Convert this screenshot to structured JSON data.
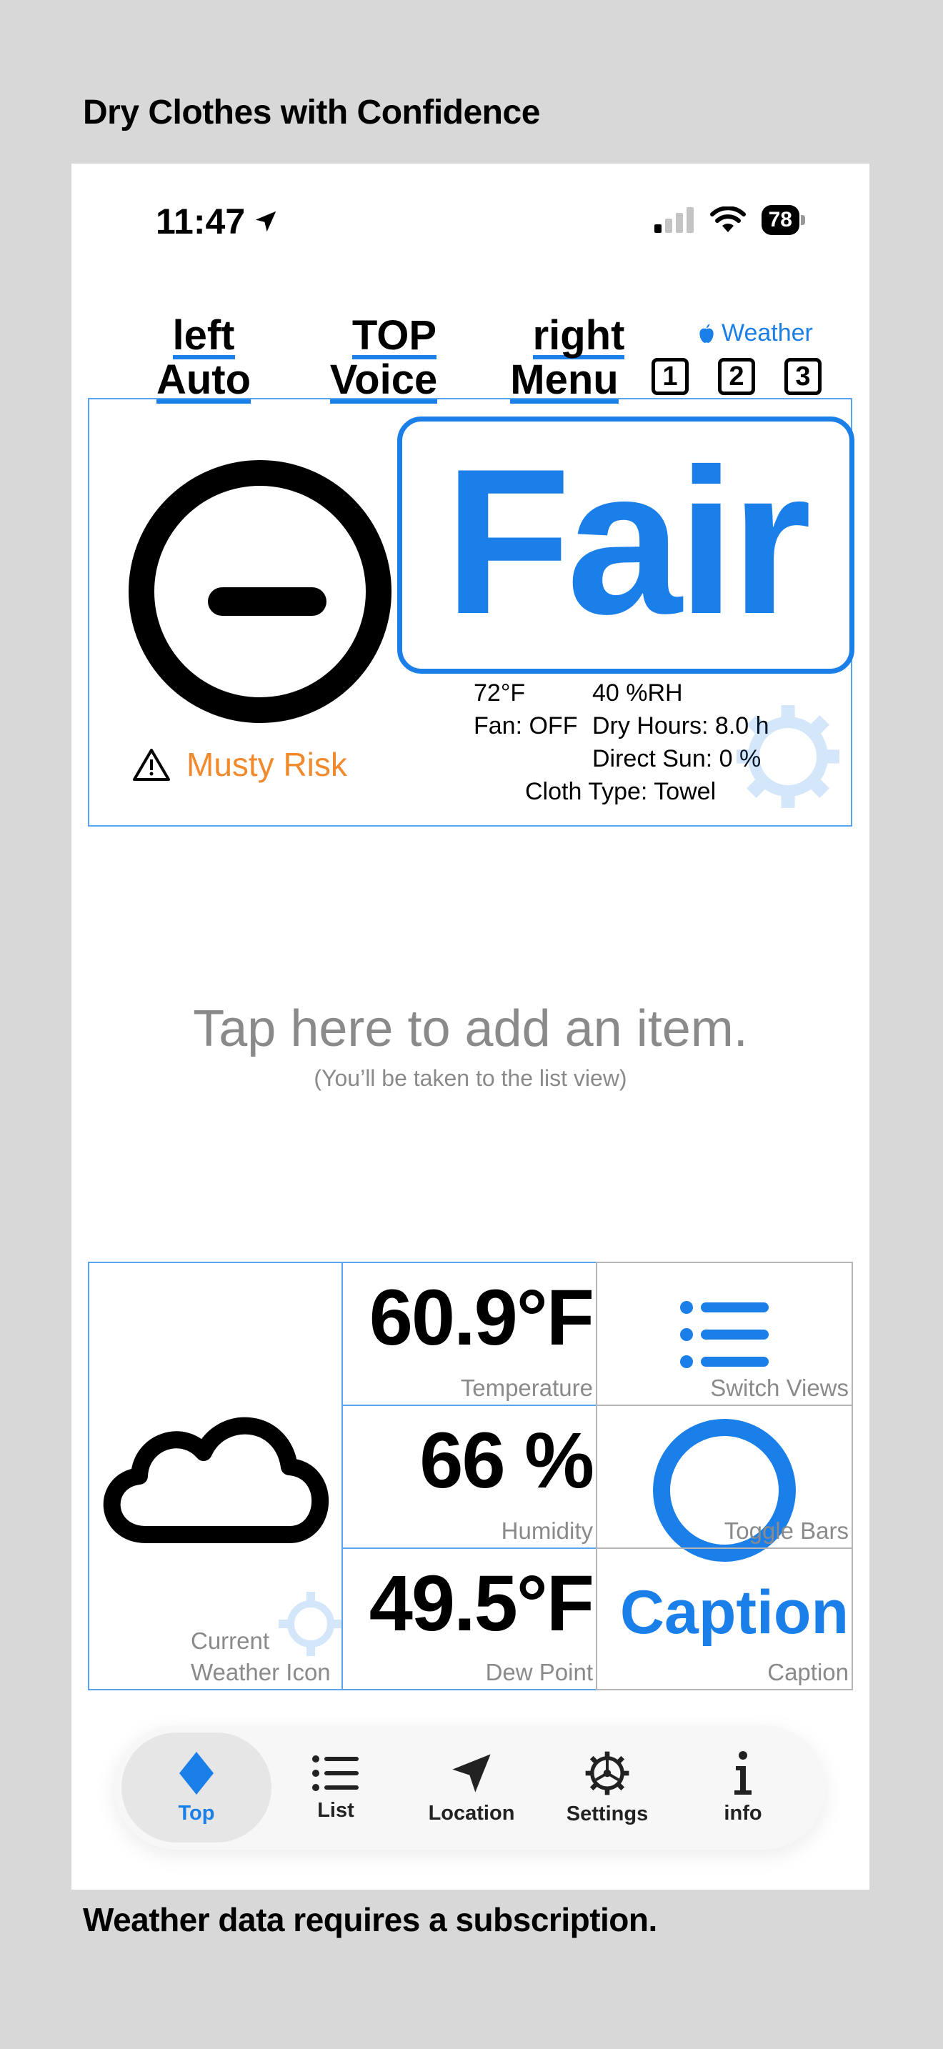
{
  "promo": {
    "headline": "Dry Clothes with Confidence",
    "footer": "Weather data requires a subscription."
  },
  "status_bar": {
    "time": "11:47",
    "battery": "78",
    "icons": [
      "location-arrow-icon",
      "cellular-signal-icon",
      "wifi-icon",
      "battery-icon"
    ]
  },
  "header": {
    "left": {
      "line1": "left",
      "line2": "Auto"
    },
    "top": {
      "line1": "TOP",
      "line2": "Voice"
    },
    "right": {
      "line1": "right",
      "line2": "Menu"
    },
    "weather_attribution": "Weather",
    "slots": [
      "1",
      "2",
      "3"
    ]
  },
  "status_panel": {
    "rating": "Fair",
    "warning": "Musty Risk",
    "temperature": "72°F",
    "humidity": "40 %RH",
    "fan": "Fan: OFF",
    "dry_hours": "Dry Hours: 8.0 h",
    "direct_sun": "Direct Sun: 0 %",
    "cloth_type": "Cloth Type: Towel",
    "colors": {
      "accent": "#1a7fe8",
      "warning": "#f08a2d"
    }
  },
  "empty_list": {
    "title": "Tap here to add an item.",
    "subtitle": "(You’ll be taken to the list view)"
  },
  "weather_grid": {
    "icon_label_1": "Current",
    "icon_label_2": "Weather Icon",
    "temperature": {
      "value": "60.9°F",
      "label": "Temperature"
    },
    "humidity": {
      "value": "66 %",
      "label": "Humidity"
    },
    "dew_point": {
      "value": "49.5°F",
      "label": "Dew Point"
    },
    "switch_views": {
      "label": "Switch Views"
    },
    "toggle_bars": {
      "label": "Toggle Bars"
    },
    "caption": {
      "value": "Caption",
      "label": "Caption"
    }
  },
  "tab_bar": {
    "active": "Top",
    "tabs": [
      {
        "label": "Top",
        "icon": "diamond-icon"
      },
      {
        "label": "List",
        "icon": "list-icon"
      },
      {
        "label": "Location",
        "icon": "location-arrow-icon"
      },
      {
        "label": "Settings",
        "icon": "gear-icon"
      },
      {
        "label": "info",
        "icon": "info-icon"
      }
    ]
  }
}
